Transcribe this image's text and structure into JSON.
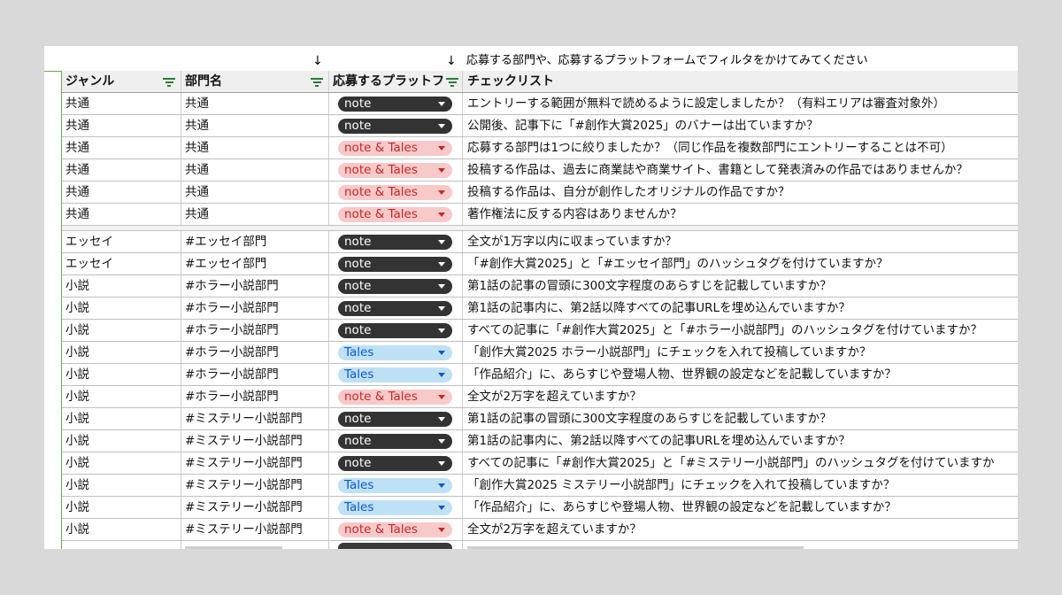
{
  "note": {
    "arrow_left": "↓",
    "arrow_right": "↓",
    "text": "応募する部門や、応募するプラットフォームでフィルタをかけてみてください"
  },
  "header": {
    "genre": "ジャンル",
    "department": "部門名",
    "platform": "応募するプラットフ",
    "checklist": "チェックリスト"
  },
  "colors": {
    "note": "#333333",
    "note_and_tales": "#f8c9c9",
    "tales": "#bfe1f6",
    "filter_icon": "#2e7d32",
    "border_accent": "#6aa84f"
  },
  "rows_common": [
    {
      "genre": "共通",
      "department": "共通",
      "platform": "note",
      "platform_style": "dark",
      "check": "エントリーする範囲が無料で読めるように設定しましたか？（有料エリアは審査対象外）"
    },
    {
      "genre": "共通",
      "department": "共通",
      "platform": "note",
      "platform_style": "dark",
      "check": "公開後、記事下に「#創作大賞2025」のバナーは出ていますか？"
    },
    {
      "genre": "共通",
      "department": "共通",
      "platform": "note & Tales",
      "platform_style": "pink",
      "check": "応募する部門は1つに絞りましたか？（同じ作品を複数部門にエントリーすることは不可）"
    },
    {
      "genre": "共通",
      "department": "共通",
      "platform": "note & Tales",
      "platform_style": "pink",
      "check": "投稿する作品は、過去に商業誌や商業サイト、書籍として発表済みの作品ではありませんか？"
    },
    {
      "genre": "共通",
      "department": "共通",
      "platform": "note & Tales",
      "platform_style": "pink",
      "check": "投稿する作品は、自分が創作したオリジナルの作品ですか？"
    },
    {
      "genre": "共通",
      "department": "共通",
      "platform": "note & Tales",
      "platform_style": "pink",
      "check": "著作権法に反する内容はありませんか？"
    }
  ],
  "rows_specific": [
    {
      "genre": "エッセイ",
      "department": "#エッセイ部門",
      "platform": "note",
      "platform_style": "dark",
      "check": "全文が1万字以内に収まっていますか？"
    },
    {
      "genre": "エッセイ",
      "department": "#エッセイ部門",
      "platform": "note",
      "platform_style": "dark",
      "check": "「#創作大賞2025」と「#エッセイ部門」のハッシュタグを付けていますか？"
    },
    {
      "genre": "小説",
      "department": "#ホラー小説部門",
      "platform": "note",
      "platform_style": "dark",
      "check": "第1話の記事の冒頭に300文字程度のあらすじを記載していますか？"
    },
    {
      "genre": "小説",
      "department": "#ホラー小説部門",
      "platform": "note",
      "platform_style": "dark",
      "check": "第1話の記事内に、第2話以降すべての記事URLを埋め込んでいますか？"
    },
    {
      "genre": "小説",
      "department": "#ホラー小説部門",
      "platform": "note",
      "platform_style": "dark",
      "check": "すべての記事に「#創作大賞2025」と「#ホラー小説部門」のハッシュタグを付けていますか？"
    },
    {
      "genre": "小説",
      "department": "#ホラー小説部門",
      "platform": "Tales",
      "platform_style": "blue",
      "check": "「創作大賞2025 ホラー小説部門」にチェックを入れて投稿していますか？"
    },
    {
      "genre": "小説",
      "department": "#ホラー小説部門",
      "platform": "Tales",
      "platform_style": "blue",
      "check": "「作品紹介」に、あらすじや登場人物、世界観の設定などを記載していますか？"
    },
    {
      "genre": "小説",
      "department": "#ホラー小説部門",
      "platform": "note & Tales",
      "platform_style": "pink",
      "check": "全文が2万字を超えていますか？"
    },
    {
      "genre": "小説",
      "department": "#ミステリー小説部門",
      "platform": "note",
      "platform_style": "dark",
      "check": "第1話の記事の冒頭に300文字程度のあらすじを記載していますか？"
    },
    {
      "genre": "小説",
      "department": "#ミステリー小説部門",
      "platform": "note",
      "platform_style": "dark",
      "check": "第1話の記事内に、第2話以降すべての記事URLを埋め込んでいますか？"
    },
    {
      "genre": "小説",
      "department": "#ミステリー小説部門",
      "platform": "note",
      "platform_style": "dark",
      "check": "すべての記事に「#創作大賞2025」と「#ミステリー小説部門」のハッシュタグを付けていますか"
    },
    {
      "genre": "小説",
      "department": "#ミステリー小説部門",
      "platform": "Tales",
      "platform_style": "blue",
      "check": "「創作大賞2025 ミステリー小説部門」にチェックを入れて投稿していますか？"
    },
    {
      "genre": "小説",
      "department": "#ミステリー小説部門",
      "platform": "Tales",
      "platform_style": "blue",
      "check": "「作品紹介」に、あらすじや登場人物、世界観の設定などを記載していますか？"
    },
    {
      "genre": "小説",
      "department": "#ミステリー小説部門",
      "platform": "note & Tales",
      "platform_style": "pink",
      "check": "全文が2万字を超えていますか？"
    }
  ]
}
